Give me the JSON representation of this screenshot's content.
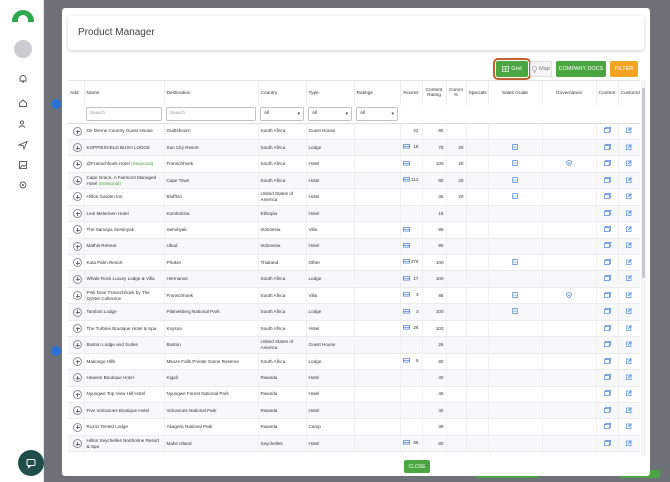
{
  "modal": {
    "title": "Product Manager",
    "close_label": "CLOSE"
  },
  "toolbar": {
    "grid_label": "Grid",
    "map_label": "Map",
    "docs_label": "COMPANY DOCS",
    "filter_label": "FILTER"
  },
  "columns": {
    "add": "Add",
    "name": "Name",
    "destination": "Destination",
    "country": "Country",
    "type": "Type",
    "ratings": "Ratings",
    "rooms": "Rooms",
    "content_rating": "Content Rating",
    "comm": "Comm %",
    "specials": "Specials",
    "sales_guide": "Sales Guide",
    "governance": "Governance",
    "content": "Content",
    "customize": "Customize"
  },
  "filters": {
    "name_placeholder": "Search",
    "destination_placeholder": "Search",
    "country_value": "All",
    "type_value": "All",
    "ratings_value": "All"
  },
  "colors": {
    "accent_green": "#49a640",
    "filter_orange": "#f3a521",
    "icon_blue": "#2a6fd6"
  },
  "rows": [
    {
      "name": "De Denne Country Guest House",
      "seasonal": "",
      "destination": "Oudtshoorn",
      "country": "South Africa",
      "type": "Guest House",
      "rooms_icon": false,
      "rooms": "22",
      "content_rating": "80",
      "comm": "",
      "sales_guide": false,
      "governance": false
    },
    {
      "name": "KOPPIESVELD BUSH LODGE",
      "seasonal": "",
      "destination": "Sun City Resort",
      "country": "South Africa",
      "type": "Lodge",
      "rooms_icon": true,
      "rooms": "18",
      "content_rating": "70",
      "comm": "20",
      "sales_guide": true,
      "governance": false
    },
    {
      "name": "@Franschhoek Hotel",
      "seasonal": "(Seasonal)",
      "destination": "Franschhoek",
      "country": "South Africa",
      "type": "Hotel",
      "rooms_icon": true,
      "rooms": "",
      "content_rating": "100",
      "comm": "20",
      "sales_guide": true,
      "governance": true
    },
    {
      "name": "Cape Grace, A Fairmont Managed Hotel",
      "seasonal": "(Seasonal)",
      "destination": "Cape Town",
      "country": "South Africa",
      "type": "Hotel",
      "rooms_icon": true,
      "rooms": "112",
      "content_rating": "80",
      "comm": "20",
      "sales_guide": true,
      "governance": false
    },
    {
      "name": "Hilton Garden Inn",
      "seasonal": "",
      "destination": "Bluffton",
      "country": "United States of America",
      "type": "Hotel",
      "rooms_icon": false,
      "rooms": "",
      "content_rating": "35",
      "comm": "20",
      "sales_guide": true,
      "governance": false
    },
    {
      "name": "Leul Melennen Hotel",
      "seasonal": "",
      "destination": "Kombolcha",
      "country": "Ethiopia",
      "type": "Hotel",
      "rooms_icon": false,
      "rooms": "",
      "content_rating": "15",
      "comm": "",
      "sales_guide": false,
      "governance": false
    },
    {
      "name": "The Samaya Seminyak",
      "seasonal": "",
      "destination": "Seminyak",
      "country": "Indonesia",
      "type": "Villa",
      "rooms_icon": true,
      "rooms": "",
      "content_rating": "85",
      "comm": "",
      "sales_guide": false,
      "governance": false
    },
    {
      "name": "Mathis Retreat",
      "seasonal": "",
      "destination": "Ubud",
      "country": "Indonesia",
      "type": "Hotel",
      "rooms_icon": true,
      "rooms": "",
      "content_rating": "90",
      "comm": "",
      "sales_guide": false,
      "governance": false
    },
    {
      "name": "Kata Palm Resort",
      "seasonal": "",
      "destination": "Phuket",
      "country": "Thailand",
      "type": "Other",
      "rooms_icon": true,
      "rooms": "276",
      "content_rating": "100",
      "comm": "",
      "sales_guide": true,
      "governance": false
    },
    {
      "name": "Whale Rock Luxury Lodge & Villa",
      "seasonal": "",
      "destination": "Hermanus",
      "country": "South Africa",
      "type": "Lodge",
      "rooms_icon": true,
      "rooms": "17",
      "content_rating": "100",
      "comm": "",
      "sales_guide": false,
      "governance": false
    },
    {
      "name": "Pink Door Franschhoek by The Oyster Collection",
      "seasonal": "",
      "destination": "Franschhoek",
      "country": "South Africa",
      "type": "Villa",
      "rooms_icon": true,
      "rooms": "3",
      "content_rating": "85",
      "comm": "",
      "sales_guide": true,
      "governance": true
    },
    {
      "name": "Tamboti Lodge",
      "seasonal": "",
      "destination": "Pilanesberg National Park",
      "country": "South Africa",
      "type": "Lodge",
      "rooms_icon": true,
      "rooms": "3",
      "content_rating": "100",
      "comm": "",
      "sales_guide": true,
      "governance": false
    },
    {
      "name": "The Turbine Boutique Hotel & Spa",
      "seasonal": "",
      "destination": "Knysna",
      "country": "South Africa",
      "type": "Hotel",
      "rooms_icon": true,
      "rooms": "26",
      "content_rating": "100",
      "comm": "",
      "sales_guide": false,
      "governance": false
    },
    {
      "name": "Boston Lodge and Suites",
      "seasonal": "",
      "destination": "Boston",
      "country": "United States of America",
      "type": "Guest House",
      "rooms_icon": false,
      "rooms": "",
      "content_rating": "26",
      "comm": "",
      "sales_guide": false,
      "governance": false
    },
    {
      "name": "Makongo Hills",
      "seasonal": "",
      "destination": "Mkuze Falls Private Game Reserve",
      "country": "South Africa",
      "type": "Lodge",
      "rooms_icon": true,
      "rooms": "5",
      "content_rating": "80",
      "comm": "",
      "sales_guide": false,
      "governance": false
    },
    {
      "name": "Heaven Boutique Hotel",
      "seasonal": "",
      "destination": "Kigali",
      "country": "Rwanda",
      "type": "Hotel",
      "rooms_icon": false,
      "rooms": "",
      "content_rating": "40",
      "comm": "",
      "sales_guide": false,
      "governance": false
    },
    {
      "name": "Nyungwe Top View Hill Hotel",
      "seasonal": "",
      "destination": "Nyungwe Forest National Park",
      "country": "Rwanda",
      "type": "Hotel",
      "rooms_icon": false,
      "rooms": "",
      "content_rating": "46",
      "comm": "",
      "sales_guide": false,
      "governance": false
    },
    {
      "name": "Five Volcanoes Boutique Hotel",
      "seasonal": "",
      "destination": "Volcanoes National Park",
      "country": "Rwanda",
      "type": "Hotel",
      "rooms_icon": false,
      "rooms": "",
      "content_rating": "40",
      "comm": "",
      "sales_guide": false,
      "governance": false
    },
    {
      "name": "Ruzizi Tented Lodge",
      "seasonal": "",
      "destination": "Akagera National Park",
      "country": "Rwanda",
      "type": "Camp",
      "rooms_icon": false,
      "rooms": "",
      "content_rating": "38",
      "comm": "",
      "sales_guide": false,
      "governance": false
    },
    {
      "name": "Hilton Seychelles Northolme Resort & Spa",
      "seasonal": "",
      "destination": "Mahe Island",
      "country": "Seychelles",
      "type": "Hotel",
      "rooms_icon": true,
      "rooms": "56",
      "content_rating": "80",
      "comm": "",
      "sales_guide": false,
      "governance": false
    }
  ]
}
